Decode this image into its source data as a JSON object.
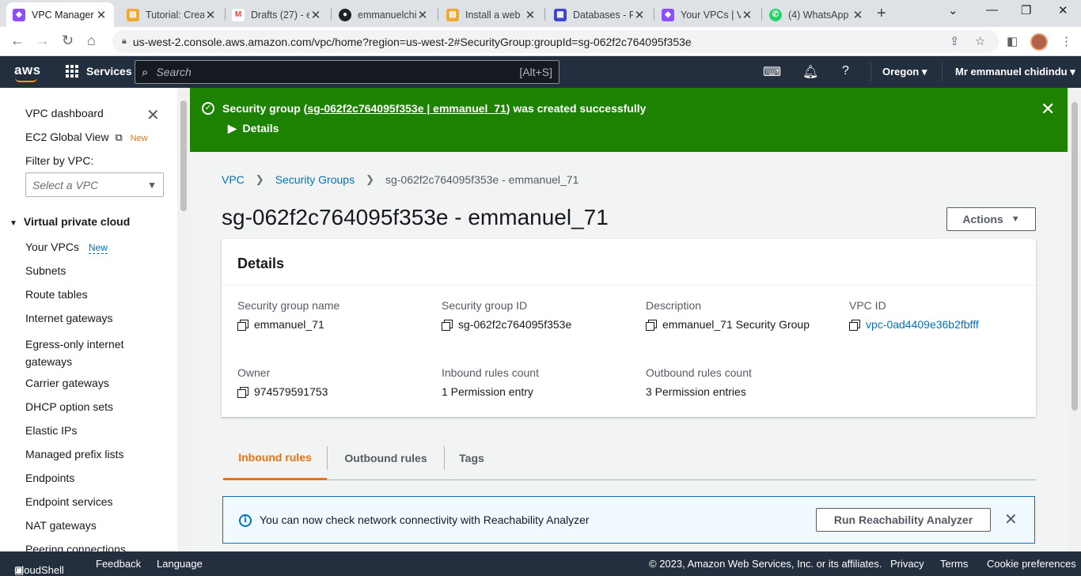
{
  "browser": {
    "tabs": [
      {
        "title": "VPC Manager",
        "icon": "vpc-favicon",
        "color": "#8c4fff"
      },
      {
        "title": "Tutorial: Crea",
        "icon": "doc-favicon",
        "color": "#f0a830"
      },
      {
        "title": "Drafts (27) - e",
        "icon": "gmail-favicon",
        "color": "#ea4335"
      },
      {
        "title": "emmanuelchi",
        "icon": "github-favicon",
        "color": "#202124"
      },
      {
        "title": "Install a web",
        "icon": "doc-favicon",
        "color": "#f0a830"
      },
      {
        "title": "Databases - R",
        "icon": "rds-favicon",
        "color": "#3b48cc"
      },
      {
        "title": "Your VPCs | V",
        "icon": "vpc-favicon",
        "color": "#8c4fff"
      },
      {
        "title": "(4) WhatsApp",
        "icon": "whatsapp-favicon",
        "color": "#25d366"
      }
    ],
    "url": "us-west-2.console.aws.amazon.com/vpc/home?region=us-west-2#SecurityGroup:groupId=sg-062f2c764095f353e"
  },
  "aws_header": {
    "logo": "aws",
    "services": "Services",
    "search_placeholder": "Search",
    "search_shortcut": "[Alt+S]",
    "region": "Oregon",
    "user": "Mr emmanuel chidindu"
  },
  "sidebar": {
    "dashboard": "VPC dashboard",
    "global_view": "EC2 Global View",
    "new_badge": "New",
    "filter_label": "Filter by VPC:",
    "filter_placeholder": "Select a VPC",
    "section": "Virtual private cloud",
    "your_vpcs": "Your VPCs",
    "your_vpcs_badge": "New",
    "items": [
      "Subnets",
      "Route tables",
      "Internet gateways",
      "Egress-only internet gateways",
      "Carrier gateways",
      "DHCP option sets",
      "Elastic IPs",
      "Managed prefix lists",
      "Endpoints",
      "Endpoint services",
      "NAT gateways",
      "Peering connections"
    ]
  },
  "flash": {
    "prefix": "Security group (",
    "link": "sg-062f2c764095f353e | emmanuel_71",
    "suffix": ") was created successfully",
    "details": "Details",
    "color": "#1d8102"
  },
  "breadcrumb": {
    "root": "VPC",
    "parent": "Security Groups",
    "current": "sg-062f2c764095f353e - emmanuel_71"
  },
  "page": {
    "title": "sg-062f2c764095f353e - emmanuel_71",
    "actions": "Actions"
  },
  "details": {
    "heading": "Details",
    "fields": {
      "sg_name": {
        "label": "Security group name",
        "value": "emmanuel_71"
      },
      "sg_id": {
        "label": "Security group ID",
        "value": "sg-062f2c764095f353e"
      },
      "description": {
        "label": "Description",
        "value": "emmanuel_71 Security Group"
      },
      "vpc_id": {
        "label": "VPC ID",
        "value": "vpc-0ad4409e36b2fbfff"
      },
      "owner": {
        "label": "Owner",
        "value": "974579591753"
      },
      "inbound": {
        "label": "Inbound rules count",
        "value": "1 Permission entry"
      },
      "outbound": {
        "label": "Outbound rules count",
        "value": "3 Permission entries"
      }
    }
  },
  "tabs": {
    "inbound": "Inbound rules",
    "outbound": "Outbound rules",
    "tags": "Tags",
    "accent": "#ec7211"
  },
  "info_alert": {
    "text": "You can now check network connectivity with Reachability Analyzer",
    "button": "Run Reachability Analyzer"
  },
  "footer": {
    "cloudshell": "CloudShell",
    "feedback": "Feedback",
    "language": "Language",
    "copyright": "© 2023, Amazon Web Services, Inc. or its affiliates.",
    "privacy": "Privacy",
    "terms": "Terms",
    "cookies": "Cookie preferences"
  }
}
